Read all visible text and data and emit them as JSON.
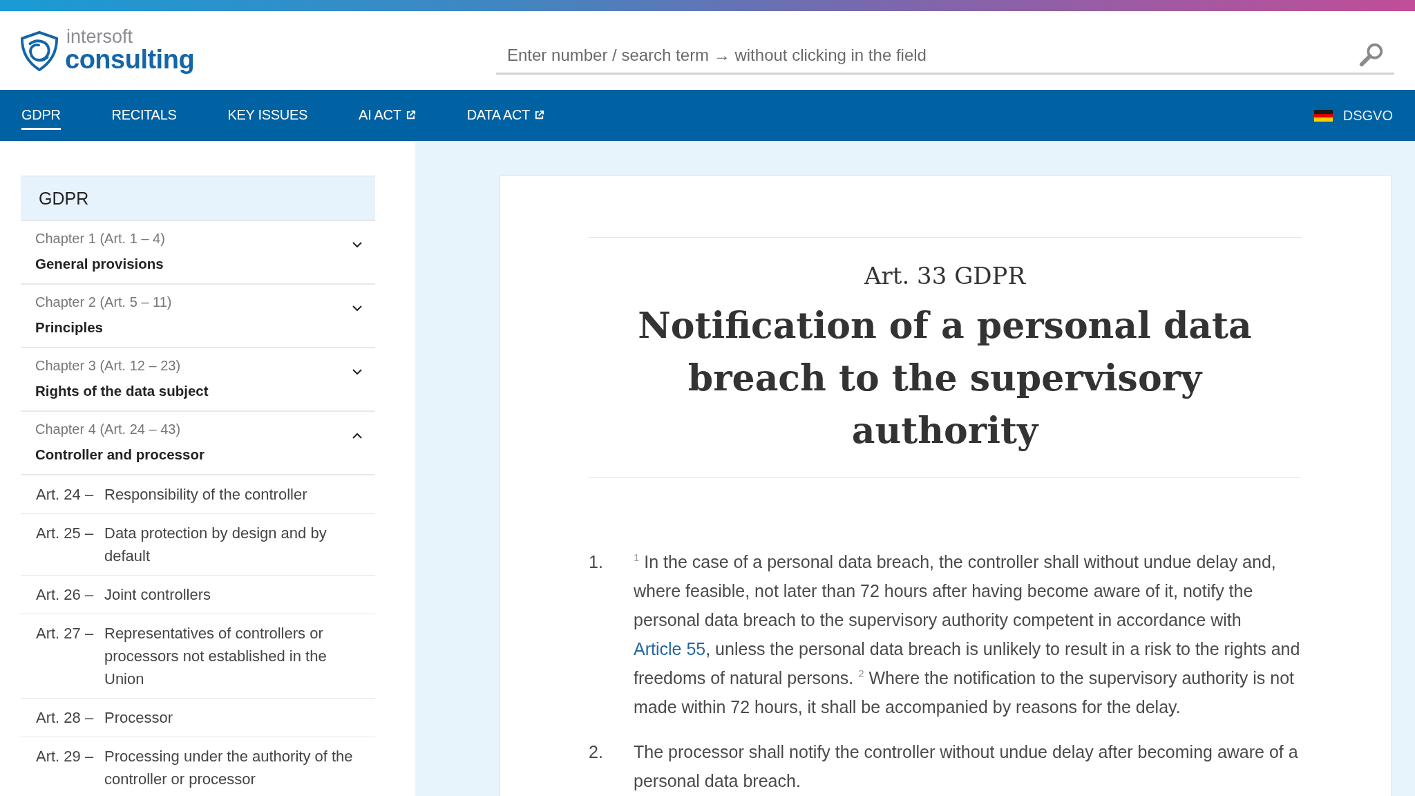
{
  "site_header": {
    "logo": {
      "line_1": "intersoft",
      "line_2": "consulting"
    },
    "search": {
      "placeholder": "Enter number / search term → without clicking in the field"
    }
  },
  "nav": {
    "items": [
      {
        "label": "GDPR",
        "selected": true,
        "external": false
      },
      {
        "label": "RECITALS",
        "selected": false,
        "external": false
      },
      {
        "label": "KEY ISSUES",
        "selected": false,
        "external": false
      },
      {
        "label": "AI ACT",
        "selected": false,
        "external": true
      },
      {
        "label": "DATA ACT",
        "selected": false,
        "external": true
      }
    ],
    "language": {
      "label": "DSGVO"
    }
  },
  "sidebar": {
    "title": "GDPR",
    "chapters": [
      {
        "label": "Chapter 1 (Art. 1 – 4)",
        "title": "General provisions",
        "expanded": false
      },
      {
        "label": "Chapter 2 (Art. 5 – 11)",
        "title": "Principles",
        "expanded": false
      },
      {
        "label": "Chapter 3 (Art. 12 – 23)",
        "title": "Rights of the data subject",
        "expanded": false
      },
      {
        "label": "Chapter 4 (Art. 24 – 43)",
        "title": "Controller and processor",
        "expanded": true,
        "children": [
          {
            "number": "Art. 24 –",
            "title": "Responsibility of the controller"
          },
          {
            "number": "Art. 25 –",
            "title": "Data protection by design and by default"
          },
          {
            "number": "Art. 26 –",
            "title": "Joint controllers"
          },
          {
            "number": "Art. 27 –",
            "title": "Representatives of controllers or processors not established in the Union"
          },
          {
            "number": "Art. 28 –",
            "title": "Processor"
          },
          {
            "number": "Art. 29 –",
            "title": "Processing under the authority of the controller or processor"
          }
        ]
      }
    ]
  },
  "article": {
    "label": "Art. 33 GDPR",
    "title": "Notification of a personal data breach to the supervisory authority",
    "paragraphs": [
      {
        "number": "1.",
        "segments": [
          {
            "kind": "text",
            "text": "$^{1}$ In the case of a personal data breach, the controller shall without undue delay and, where feasible, not later than 72 hours after having become aware of it, notify the personal data breach to the supervisory authority competent in accordance with "
          },
          {
            "kind": "link",
            "text": "Article 55"
          },
          {
            "kind": "text",
            "text": ", unless the personal data breach is unlikely to result in a risk to the rights and freedoms of natural persons. $^{2}$ Where the notification to the supervisory authority is not made within 72 hours, it shall be accompanied by reasons for the delay."
          }
        ]
      },
      {
        "number": "2.",
        "segments": [
          {
            "kind": "text",
            "text": "The processor shall notify the controller without undue delay after becoming aware of a personal data breach."
          }
        ]
      }
    ]
  }
}
